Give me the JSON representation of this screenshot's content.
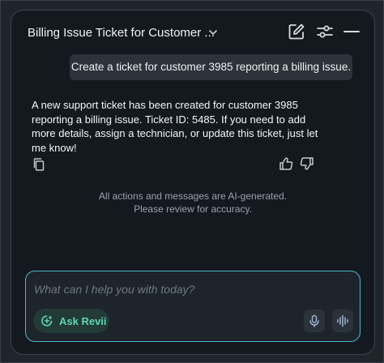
{
  "header": {
    "title": "Billing Issue Ticket for Customer ...",
    "icons": [
      "chevron-down-icon",
      "edit-icon",
      "settings-sliders-icon",
      "minimize-icon"
    ]
  },
  "messages": {
    "user": "Create a ticket for customer 3985 reporting a billing issue.",
    "assistant": "A new support ticket has been created for customer 3985 reporting a billing issue. Ticket ID: 5485. If you need to add more details, assign a technician, or update this ticket, just let me know!"
  },
  "disclaimer": {
    "line1": "All actions and messages are AI-generated.",
    "line2": "Please review for accuracy."
  },
  "composer": {
    "placeholder": "What can I help you with today?",
    "ask_label": "Ask Revii"
  },
  "colors": {
    "panel_bg": "#14191f",
    "accent_teal": "#4fb6cf",
    "ask_green": "#5fd6b0"
  }
}
